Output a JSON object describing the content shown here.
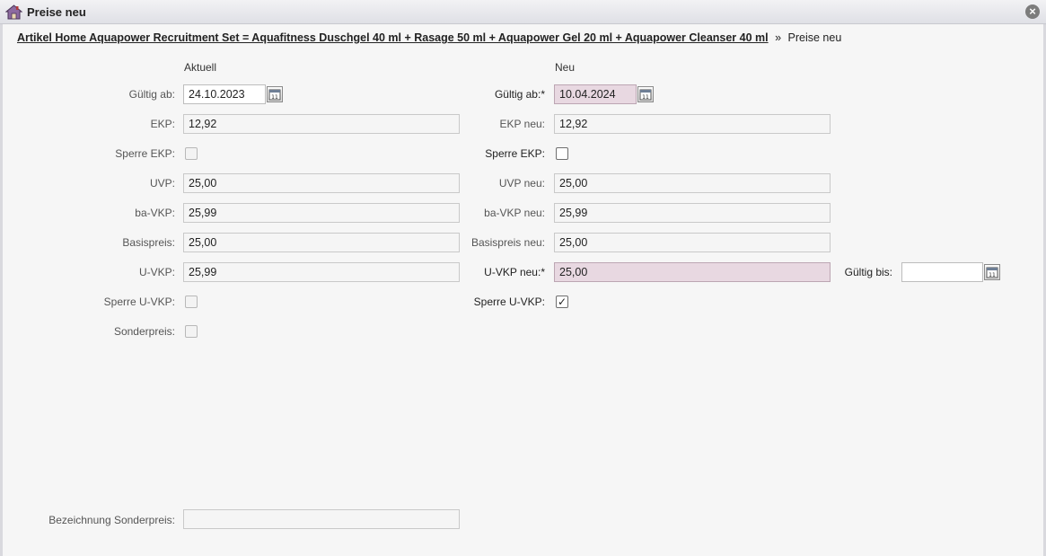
{
  "window": {
    "title": "Preise neu",
    "icon": "house-icon",
    "close": "close-icon"
  },
  "breadcrumb": {
    "link": "Artikel Home Aquapower Recruitment Set = Aquafitness Duschgel 40 ml + Rasage 50 ml + Aquapower Gel 20 ml + Aquapower Cleanser 40 ml",
    "separator": "»",
    "current": "Preise neu"
  },
  "columns": {
    "current": "Aktuell",
    "new": "Neu"
  },
  "current": {
    "valid_from_label": "Gültig ab:",
    "valid_from_value": "24.10.2023",
    "ekp_label": "EKP:",
    "ekp_value": "12,92",
    "lock_ekp_label": "Sperre EKP:",
    "lock_ekp_checked": false,
    "uvp_label": "UVP:",
    "uvp_value": "25,00",
    "bavkp_label": "ba-VKP:",
    "bavkp_value": "25,99",
    "basis_label": "Basispreis:",
    "basis_value": "25,00",
    "uvkp_label": "U-VKP:",
    "uvkp_value": "25,99",
    "lock_uvkp_label": "Sperre U-VKP:",
    "lock_uvkp_checked": false,
    "special_label": "Sonderpreis:",
    "special_checked": false,
    "special_name_label": "Bezeichnung Sonderpreis:",
    "special_name_value": ""
  },
  "new": {
    "valid_from_label": "Gültig ab:*",
    "valid_from_value": "10.04.2024",
    "ekp_label": "EKP neu:",
    "ekp_value": "12,92",
    "lock_ekp_label": "Sperre EKP:",
    "lock_ekp_checked": false,
    "uvp_label": "UVP neu:",
    "uvp_value": "25,00",
    "bavkp_label": "ba-VKP neu:",
    "bavkp_value": "25,99",
    "basis_label": "Basispreis neu:",
    "basis_value": "25,00",
    "uvkp_label": "U-VKP neu:*",
    "uvkp_value": "25,00",
    "lock_uvkp_label": "Sperre U-VKP:",
    "lock_uvkp_checked": true,
    "valid_to_label": "Gültig bis:",
    "valid_to_value": "",
    "checkmark": "✓"
  },
  "icons": {
    "calendar": "calendar-icon",
    "calendar_day": "11"
  },
  "colors": {
    "required_field": "#e8d8e1",
    "readonly_field": "#f5f5f5"
  }
}
